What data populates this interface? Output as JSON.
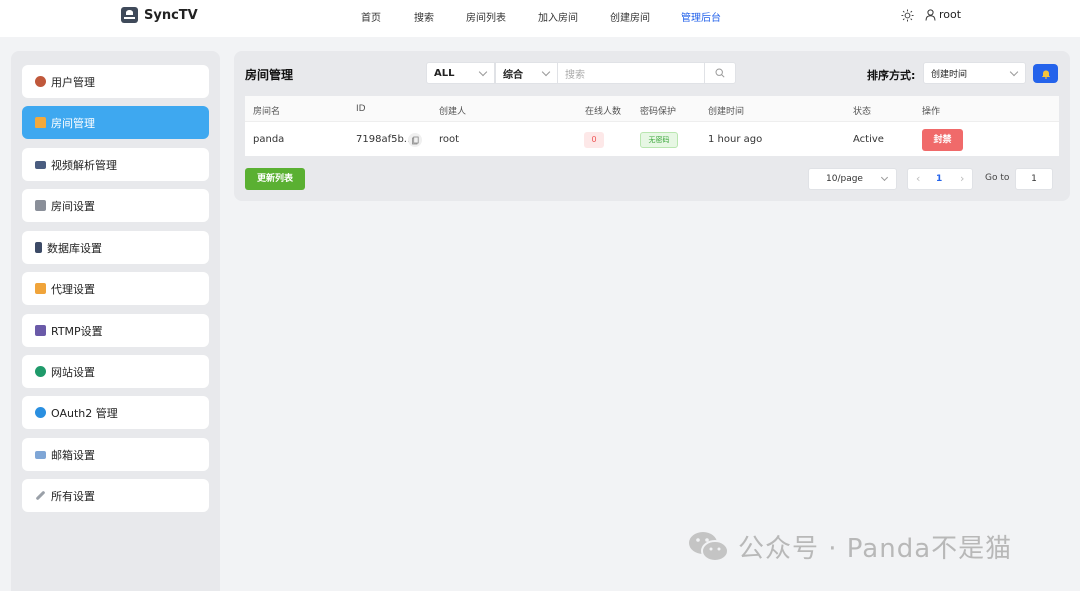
{
  "app": {
    "name": "SyncTV"
  },
  "nav": {
    "items": [
      "首页",
      "搜索",
      "房间列表",
      "加入房间",
      "创建房间",
      "管理后台"
    ],
    "active": "管理后台"
  },
  "user": {
    "name": "root"
  },
  "sidebar": {
    "items": [
      {
        "label": "用户管理",
        "icon": "user-group-icon"
      },
      {
        "label": "房间管理",
        "icon": "house-icon"
      },
      {
        "label": "视频解析管理",
        "icon": "film-icon"
      },
      {
        "label": "房间设置",
        "icon": "building-icon"
      },
      {
        "label": "数据库设置",
        "icon": "phone-icon"
      },
      {
        "label": "代理设置",
        "icon": "cat-icon"
      },
      {
        "label": "RTMP设置",
        "icon": "people-icon"
      },
      {
        "label": "网站设置",
        "icon": "globe-icon"
      },
      {
        "label": "OAuth2 管理",
        "icon": "drop-icon"
      },
      {
        "label": "邮箱设置",
        "icon": "mail-icon"
      },
      {
        "label": "所有设置",
        "icon": "wrench-icon"
      }
    ],
    "active_index": 1
  },
  "room_panel": {
    "title": "房间管理",
    "filter_status": "ALL",
    "filter_type": "综合",
    "search_placeholder": "搜索",
    "sort_label": "排序方式:",
    "sort_value": "创建时间",
    "columns": [
      "房间名",
      "ID",
      "创建人",
      "在线人数",
      "密码保护",
      "创建时间",
      "状态",
      "操作"
    ],
    "rows": [
      {
        "name": "panda",
        "id": "7198af5b...",
        "creator": "root",
        "online": "0",
        "password": "无密码",
        "created": "1 hour ago",
        "status": "Active",
        "action": "封禁"
      }
    ],
    "refresh_label": "更新列表",
    "page_size": "10/page",
    "current_page": "1",
    "goto_label": "Go to",
    "goto_value": "1"
  },
  "watermark": {
    "text": "公众号 · Panda不是猫"
  },
  "colors": {
    "accent": "#2463eb",
    "sidebar_active": "#3ea8f0",
    "ban": "#f06a6a",
    "refresh": "#5ab032"
  }
}
